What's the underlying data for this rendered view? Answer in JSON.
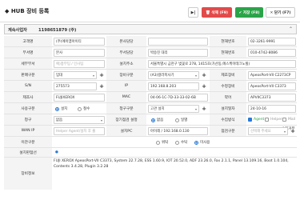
{
  "header": {
    "title": "◆ HUB 장비 등록",
    "btn_ctl": "▶|",
    "btn_delete": "🗑 삭제 (F9)",
    "btn_save": "✔ 저장 (F8)",
    "btn_close": "✕ 닫기 (F7)"
  },
  "contract": {
    "label": "계속사업자",
    "value": "1198651879    (주)",
    "chev": "⌃"
  },
  "rows": {
    "r1": {
      "l1": "고객명",
      "v1": "(주)에이엠아이티",
      "l2": "본사담당",
      "v2": "",
      "l3": "현해번호",
      "v3": "02-3261-9991"
    },
    "r2": {
      "l1": "부서명",
      "v1": "본사",
      "l2": "부서담당",
      "v2": "박승진 대리",
      "l3": "현해번호",
      "v3": "010-4742-8086"
    },
    "r3": {
      "l1": "세부부서",
      "v1": "예)총무팀 / 인사팀",
      "l2": "설치주소",
      "v2": "서울특별시 금천구 벚꽃로 278, 1415호(가산동,에스케이테크노빌)"
    },
    "r4": {
      "l1": "판매구분",
      "v1": "임대",
      "l2": "장비구분",
      "v2": "(A3)컬러복사기",
      "l3": "제조장비",
      "v3": "ApeosPort-VII C2273CP"
    },
    "r5": {
      "l1": "S/N",
      "v1": "275573",
      "l2": "IP",
      "v2": "192.168.8.203",
      "l3": "수정장비",
      "v3": "ApeosPort-VII C3373"
    },
    "r6": {
      "l1": "제조사",
      "v1": "FUJIXEROX",
      "l2": "MAC",
      "v2": "04-06-1C-7D-33-33-02-6B",
      "l3": "약어",
      "v3": "APVIIC3373"
    },
    "r7": {
      "l1": "사용구분",
      "v1": "설치",
      "v1b": "철수",
      "l2": "청구구분",
      "v2": "고관 설치",
      "l3": "설치일자",
      "v3": "24-10-16"
    },
    "r8": {
      "l1": "청구",
      "v1": "없음",
      "l2": "장기점검 설정",
      "v2a": "없음",
      "v2b": "일별",
      "l3": "수집방식",
      "v3a": "Agent",
      "v3b": "Helper",
      "v3c": "Mail",
      "v3d": "수집거부"
    },
    "r9": {
      "l1": "WAN IP",
      "v1": "Helper Agent/설치 후 출",
      "l2": "설치PC",
      "v2": "아이레 / 192.168.0.130",
      "l3": "점검구분",
      "v3": "선택해 주세요"
    },
    "r10": {
      "l1": "이관구분",
      "v1a": "위탁",
      "v1b": "수탁",
      "v1c": "미사용"
    },
    "r11": {
      "l1": "설치판점선",
      "v1": "●"
    },
    "r12": {
      "l1": "장비정보",
      "v1": "FUJI XEROX ApeosPort-VII C3373, System 22.7.28, ESS 1.60.9, IOT 20.52.0, ADF 23.26.0, Fax 2.1.1, Panel 13.109.16, Boot 1.0.104, Contents 3.4.28, Plugin 3.2.28"
    }
  },
  "icons": {
    "plus": "+",
    "select": "chevron-down-icon"
  }
}
